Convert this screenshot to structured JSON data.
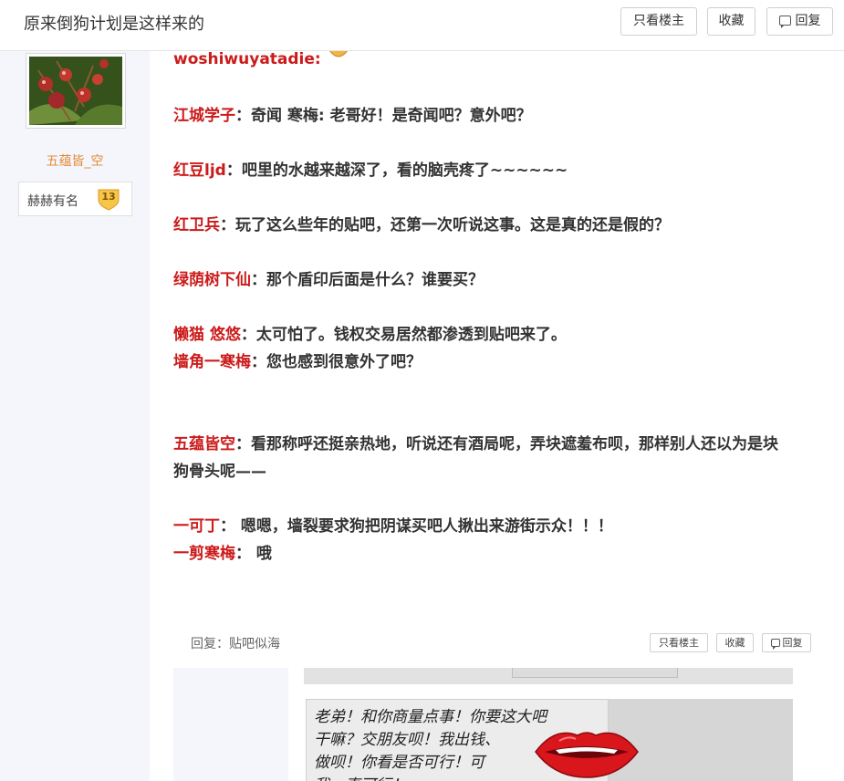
{
  "header": {
    "title": "原来倒狗计划是这样来的",
    "only_author_label": "只看楼主",
    "favorite_label": "收藏",
    "reply_label": "回复"
  },
  "author": {
    "username": "五蕴皆_空",
    "level_name": "赫赫有名",
    "level": "13"
  },
  "post": {
    "cut_top_line": "woshiwuyatadie:",
    "lines": [
      {
        "name": "江城学子",
        "text": "奇闻 寒梅: 老哥好！是奇闻吧？意外吧？"
      },
      {
        "name": "红豆ljd",
        "text": "吧里的水越来越深了，看的脑壳疼了~~~~~~"
      },
      {
        "name": "红卫兵",
        "text": "玩了这么些年的贴吧，还第一次听说这事。这是真的还是假的？"
      },
      {
        "name": "绿荫树下仙",
        "text": "那个盾印后面是什么？谁要买？"
      },
      {
        "name": "懒猫 悠悠",
        "text": "太可怕了。钱权交易居然都渗透到贴吧来了。"
      },
      {
        "name": "墙角一寒梅",
        "text": "您也感到很意外了吧？"
      },
      {
        "name": "五蕴皆空",
        "text": "看那称呼还挺亲热地，听说还有酒局呢，弄块遮羞布呗，那样别人还以为是块"
      },
      {
        "name": "",
        "text": "狗骨头呢——"
      },
      {
        "name": "一可丁",
        "text": " 嗯嗯，墙裂要求狗把阴谋买吧人揪出来游街示众！！！"
      },
      {
        "name": "一剪寒梅",
        "text": " 哦"
      }
    ],
    "separator": "："
  },
  "embedded": {
    "title": "回复：贴吧似海",
    "only_author_label": "只看楼主",
    "favorite_label": "收藏",
    "reply_label": "回复",
    "handwriting": [
      "老弟！和你商量点事！你要这大吧",
      "干嘛？交朋友呗！我出钱、",
      "做呗！你看是否可行！可",
      "我一直可行！"
    ]
  },
  "colors": {
    "name_red": "#cc1b1b",
    "username_orange": "#e38c3b",
    "sidebar_bg": "#f4f6fb"
  }
}
